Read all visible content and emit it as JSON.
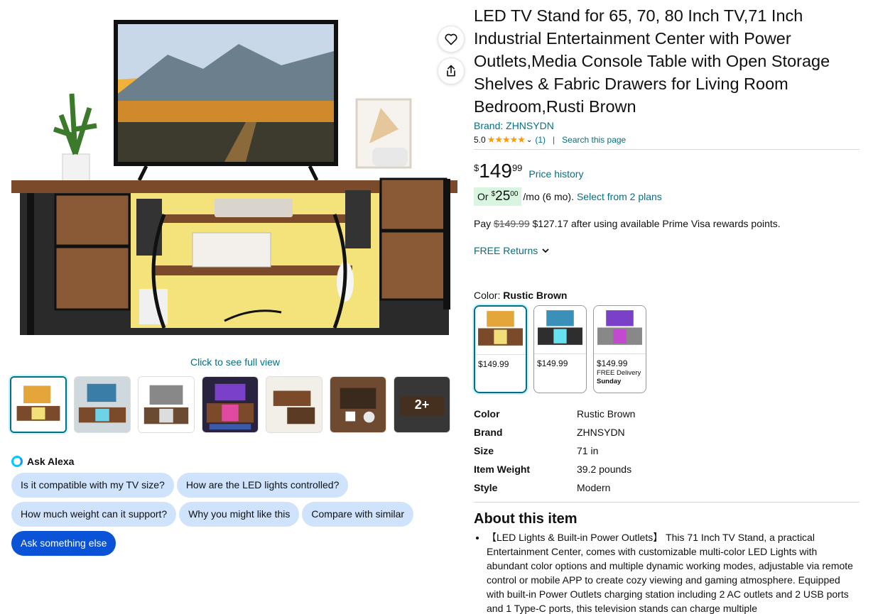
{
  "gallery": {
    "click_full_view": "Click to see full view",
    "more_badge": "2+"
  },
  "alexa": {
    "title": "Ask Alexa",
    "chips": [
      "Is it compatible with my TV size?",
      "How are the LED lights controlled?",
      "How much weight can it support?",
      "Why you might like this",
      "Compare with similar",
      "Ask something else"
    ]
  },
  "product": {
    "title": "LED TV Stand for 65, 70, 80 Inch TV,71 Inch Industrial Entertainment Center with Power Outlets,Media Console Table with Open Storage Shelves & Fabric Drawers for Living Room Bedroom,Rusti Brown",
    "brand": "Brand: ZHNSYDN",
    "rating": "5.0",
    "rating_count": "(1)",
    "search_page": "Search this page",
    "price_symbol": "$",
    "price_whole": "149",
    "price_fraction": "99",
    "price_history": "Price history",
    "install_or": "Or",
    "install_symbol": "$",
    "install_whole": "25",
    "install_fraction": "00",
    "install_suffix": "/mo (6 mo).",
    "install_plans": "Select from 2 plans",
    "pay_prefix": "Pay",
    "pay_strike": "$149.99",
    "pay_suffix": "$127.17 after using available Prime Visa rewards points.",
    "returns": "FREE Returns",
    "color_label": "Color:",
    "color_value": "Rustic Brown",
    "swatches": [
      {
        "price": "$149.99"
      },
      {
        "price": "$149.99"
      },
      {
        "price": "$149.99",
        "delivery": "FREE Delivery",
        "day": "Sunday"
      }
    ],
    "specs": [
      {
        "k": "Color",
        "v": "Rustic Brown"
      },
      {
        "k": "Brand",
        "v": "ZHNSYDN"
      },
      {
        "k": "Size",
        "v": "71 in"
      },
      {
        "k": "Item Weight",
        "v": "39.2 pounds"
      },
      {
        "k": "Style",
        "v": "Modern"
      }
    ],
    "about_heading": "About this item",
    "about_items": [
      "【LED Lights & Built-in Power Outlets】 This 71 Inch TV Stand, a practical Entertainment Center, comes with customizable multi-color LED Lights with abundant color options and multiple dynamic working modes, adjustable via remote control or mobile APP to create cozy viewing and gaming atmosphere. Equipped with built-in Power Outlets charging station including 2 AC outlets and 2 USB ports and 1 Type-C ports, this television stands can charge multiple"
    ]
  },
  "colors": {
    "link": "#007185",
    "star": "#ff9900",
    "chip": "#cfe3fd",
    "chip_primary": "#0a53d6",
    "install_bg": "#d7f5df"
  },
  "icons": [
    "heart-icon",
    "share-icon",
    "alexa-icon",
    "star-icon",
    "chevron-down-icon"
  ]
}
